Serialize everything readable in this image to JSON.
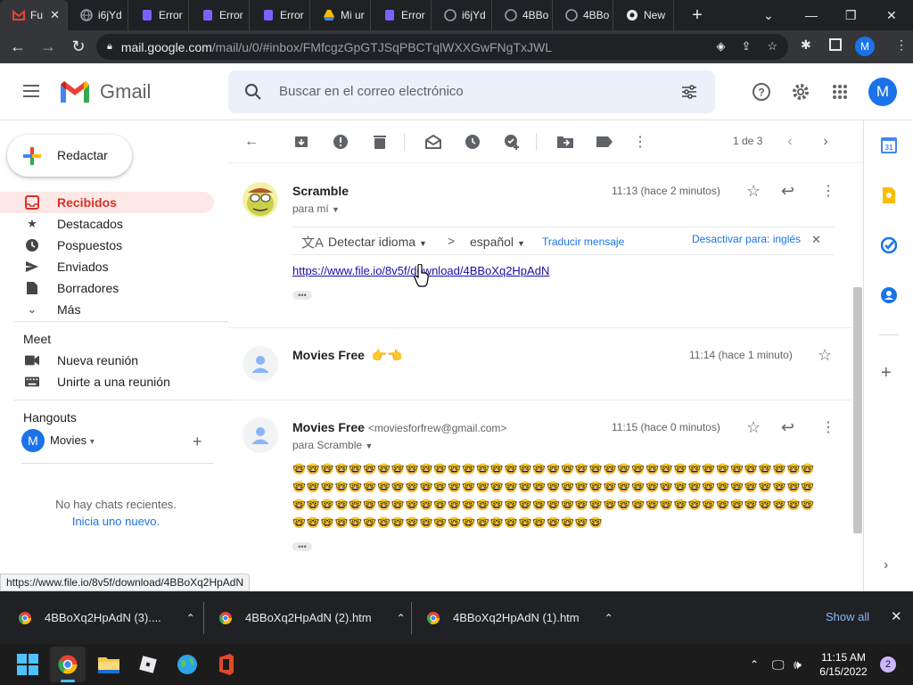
{
  "browser": {
    "tabs": [
      {
        "label": "Fu",
        "icon": "gmail-icon",
        "active": true
      },
      {
        "label": "i6jYd",
        "icon": "globe-icon"
      },
      {
        "label": "Error",
        "icon": "purple-s-icon"
      },
      {
        "label": "Error",
        "icon": "purple-s-icon"
      },
      {
        "label": "Error",
        "icon": "purple-s-icon"
      },
      {
        "label": "Mi ur",
        "icon": "drive-icon"
      },
      {
        "label": "Error",
        "icon": "purple-s-icon"
      },
      {
        "label": "i6jYd",
        "icon": "globe-icon"
      },
      {
        "label": "4BBo",
        "icon": "globe-icon"
      },
      {
        "label": "4BBo",
        "icon": "globe-icon"
      },
      {
        "label": "New",
        "icon": "chrome-icon"
      }
    ],
    "url_host": "mail.google.com",
    "url_path": "/mail/u/0/#inbox/FMfcgzGpGTJSqPBCTqlWXXGwFNgTxJWL",
    "profile_initial": "M"
  },
  "gmail": {
    "logo_text": "Gmail",
    "search_placeholder": "Buscar en el correo electrónico",
    "account_initial": "M",
    "compose_label": "Redactar",
    "nav": [
      {
        "label": "Recibidos",
        "icon": "inbox-icon"
      },
      {
        "label": "Destacados",
        "icon": "star-icon"
      },
      {
        "label": "Pospuestos",
        "icon": "clock-icon"
      },
      {
        "label": "Enviados",
        "icon": "send-icon"
      },
      {
        "label": "Borradores",
        "icon": "draft-icon"
      },
      {
        "label": "Más",
        "icon": "chevron-down-icon"
      }
    ],
    "meet": {
      "title": "Meet",
      "items": [
        {
          "label": "Nueva reunión",
          "icon": "video-icon"
        },
        {
          "label": "Unirte a una reunión",
          "icon": "keyboard-icon"
        }
      ]
    },
    "hangouts": {
      "title": "Hangouts",
      "user": "Movies",
      "user_initial": "M",
      "empty_text": "No hay chats recientes.",
      "start_link": "Inicia uno nuevo."
    },
    "toolbar": {
      "pager": "1 de 3"
    },
    "translate": {
      "detect": "Detectar idioma",
      "arrow": ">",
      "target": "español",
      "translate_link": "Traducir mensaje",
      "disable": "Desactivar para: inglés"
    },
    "messages": [
      {
        "sender": "Scramble",
        "to": "para mí",
        "time": "11:13 (hace 2 minutos)",
        "link": "https://www.file.io/8v5f/download/4BBoXq2HpAdN"
      },
      {
        "sender": "Movies Free",
        "emoji": "👉👈",
        "time": "11:14 (hace 1 minuto)"
      },
      {
        "sender": "Movies Free",
        "email": "<moviesforfrew@gmail.com>",
        "to": "para Scramble",
        "time": "11:15 (hace 0 minutos)",
        "body_lines": [
          "🤓🤓🤓🤓🤓🤓🤓🤓🤓🤓🤓🤓🤓🤓🤓🤓🤓🤓🤓🤓🤓🤓🤓🤓🤓🤓🤓🤓🤓🤓🤓🤓🤓🤓🤓🤓🤓",
          "🤓🤓🤓🤓🤓🤓🤓🤓🤓🤓🤓🤓🤓🤓🤓🤓🤓🤓🤓🤓🤓🤓🤓🤓🤓🤓🤓🤓🤓🤓🤓🤓🤓🤓🤓🤓🤓",
          "🤓🤓🤓🤓🤓🤓🤓🤓🤓🤓🤓🤓🤓🤓🤓🤓🤓🤓🤓🤓🤓🤓🤓🤓🤓🤓🤓🤓🤓🤓🤓🤓🤓🤓🤓🤓🤓",
          "🤓🤓🤓🤓🤓🤓🤓🤓🤓🤓🤓🤓🤓🤓🤓🤓🤓🤓🤓🤓🤓🤓"
        ]
      }
    ],
    "ellipsis": "•••"
  },
  "status_url": "https://www.file.io/8v5f/download/4BBoXq2HpAdN",
  "downloads": {
    "items": [
      {
        "name": "4BBoXq2HpAdN (3)...."
      },
      {
        "name": "4BBoXq2HpAdN (2).htm"
      },
      {
        "name": "4BBoXq2HpAdN (1).htm"
      }
    ],
    "show_all": "Show all"
  },
  "taskbar": {
    "time": "11:15 AM",
    "date": "6/15/2022",
    "notifications": "2"
  },
  "colors": {
    "accent": "#1a73e8",
    "inbox_active_bg": "#fce8e6",
    "inbox_active_text": "#d93025"
  }
}
